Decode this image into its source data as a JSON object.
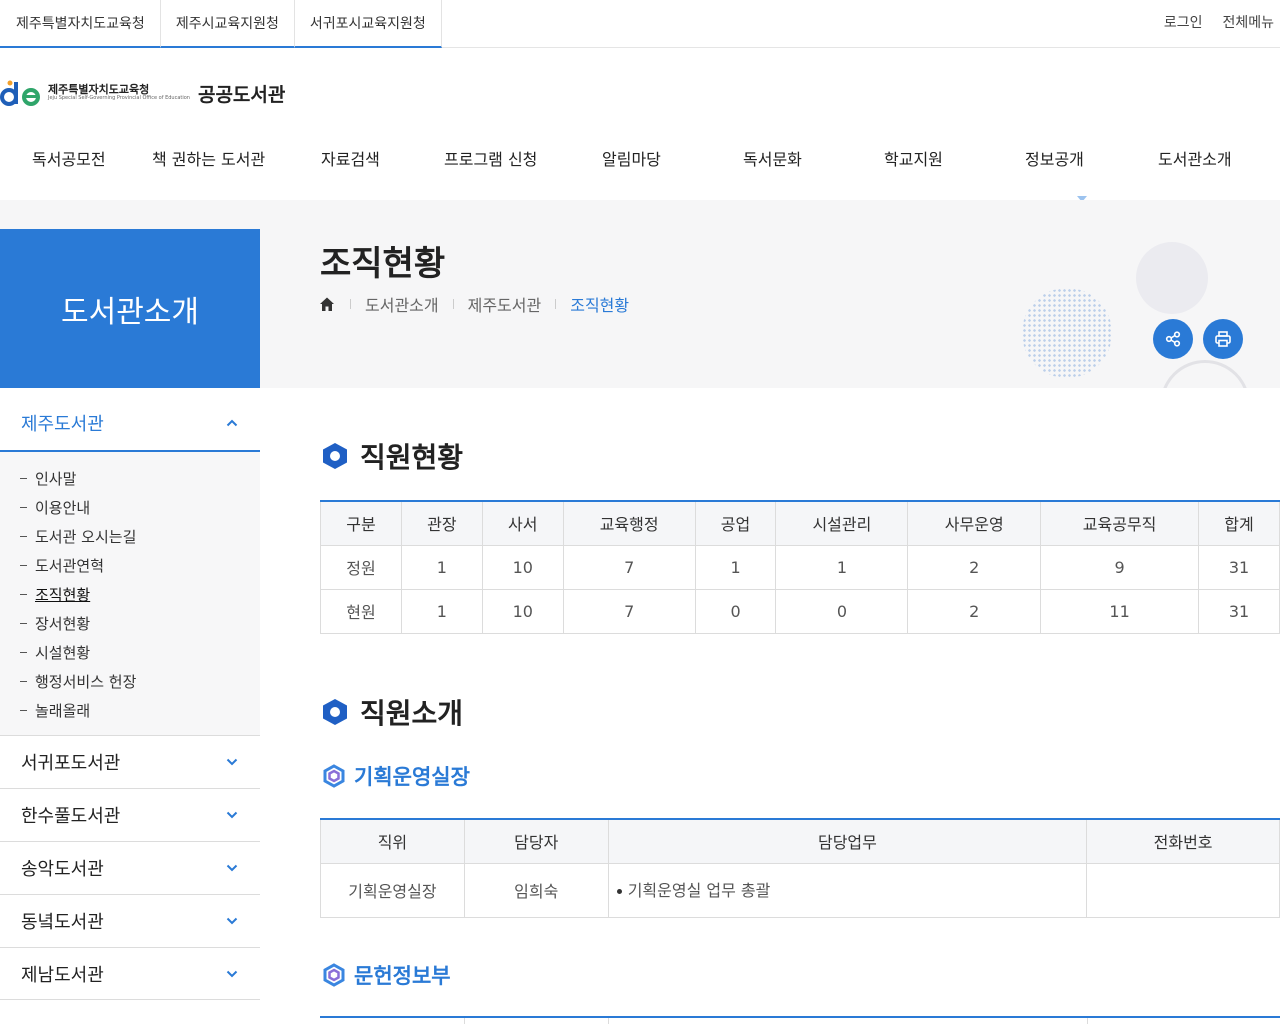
{
  "top_bar": {
    "org_tabs": [
      "제주특별자치도교육청",
      "제주시교육지원청",
      "서귀포시교육지원청"
    ],
    "login": "로그인",
    "all_menu": "전체메뉴"
  },
  "logo": {
    "org": "제주특별자치도교육청",
    "sub": "Jeju Special Self-Governing Provincial Office of Education",
    "title": "공공도서관"
  },
  "gnb": [
    "독서공모전",
    "책 권하는 도서관",
    "자료검색",
    "프로그램 신청",
    "알림마당",
    "독서문화",
    "학교지원",
    "정보공개",
    "도서관소개"
  ],
  "side_title": "도서관소개",
  "page_title": "조직현황",
  "breadcrumb": [
    "도서관소개",
    "제주도서관",
    "조직현황"
  ],
  "colors": {
    "accent": "#2a7ad6"
  },
  "icons": {
    "share": "share-icon",
    "print": "print-icon",
    "home": "home-icon"
  },
  "lnb": {
    "current": "제주도서관",
    "sub_items": [
      "인사말",
      "이용안내",
      "도서관 오시는길",
      "도서관연혁",
      "조직현황",
      "장서현황",
      "시설현황",
      "행정서비스 헌장",
      "놀래올래"
    ],
    "active_sub": "조직현황",
    "others": [
      "서귀포도서관",
      "한수풀도서관",
      "송악도서관",
      "동녘도서관",
      "제남도서관"
    ]
  },
  "staff_status": {
    "title": "직원현황",
    "headers": [
      "구분",
      "관장",
      "사서",
      "교육행정",
      "공업",
      "시설관리",
      "사무운영",
      "교육공무직",
      "합계"
    ],
    "rows": [
      [
        "정원",
        "1",
        "10",
        "7",
        "1",
        "1",
        "2",
        "9",
        "31"
      ],
      [
        "현원",
        "1",
        "10",
        "7",
        "0",
        "0",
        "2",
        "11",
        "31"
      ]
    ]
  },
  "staff_intro": {
    "title": "직원소개",
    "sections": [
      {
        "title": "기획운영실장",
        "headers": [
          "직위",
          "담당자",
          "담당업무",
          "전화번호"
        ],
        "rows": [
          [
            "기획운영실장",
            "임희숙",
            "기획운영실 업무 총괄",
            ""
          ]
        ]
      },
      {
        "title": "문헌정보부"
      }
    ]
  }
}
